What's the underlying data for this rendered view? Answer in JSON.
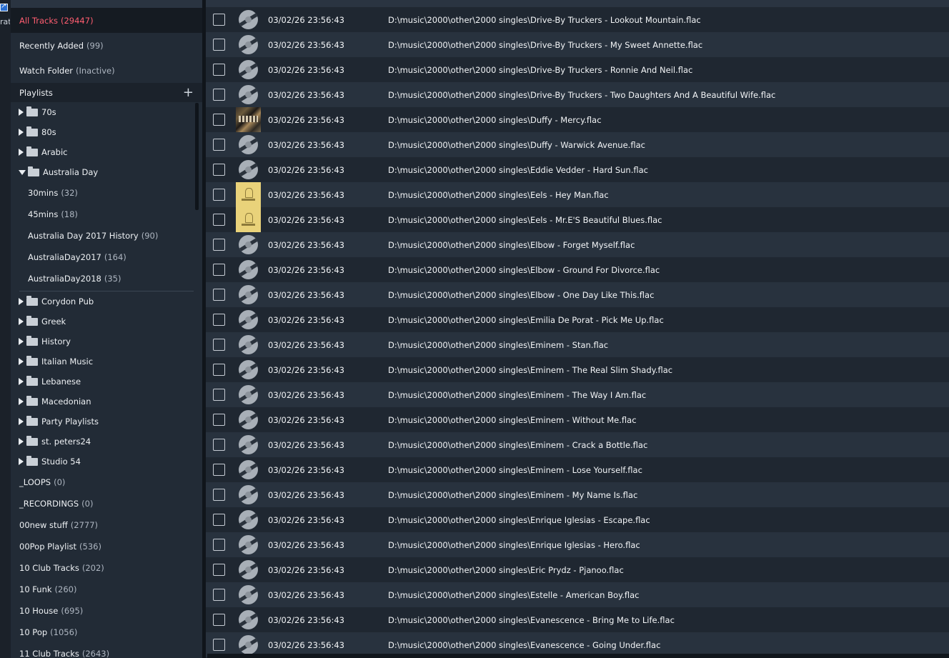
{
  "sidebar": {
    "nav": [
      {
        "label": "All Tracks",
        "count": "(29447)",
        "active": true
      },
      {
        "label": "Recently Added",
        "count": "(99)",
        "active": false
      },
      {
        "label": "Watch Folder",
        "count": "(Inactive)",
        "active": false
      }
    ],
    "playlists_header": "Playlists",
    "add_icon": "+",
    "folders_top": [
      {
        "label": "70s",
        "open": false
      },
      {
        "label": "80s",
        "open": false
      },
      {
        "label": "Arabic",
        "open": false
      },
      {
        "label": "Australia Day",
        "open": true
      }
    ],
    "australia_day_children": [
      {
        "label": "30mins",
        "count": "(32)"
      },
      {
        "label": "45mins",
        "count": "(18)"
      },
      {
        "label": "Australia Day 2017 History",
        "count": "(90)"
      },
      {
        "label": "AustraliaDay2017",
        "count": "(164)"
      },
      {
        "label": "AustraliaDay2018",
        "count": "(35)"
      }
    ],
    "folders_bottom": [
      {
        "label": "Corydon Pub"
      },
      {
        "label": "Greek"
      },
      {
        "label": "History"
      },
      {
        "label": "Italian Music"
      },
      {
        "label": "Lebanese"
      },
      {
        "label": "Macedonian"
      },
      {
        "label": "Party Playlists"
      },
      {
        "label": "st. peters24"
      },
      {
        "label": "Studio 54"
      }
    ],
    "playlists": [
      {
        "label": "_LOOPS",
        "count": "(0)"
      },
      {
        "label": "_RECORDINGS",
        "count": "(0)"
      },
      {
        "label": "00new stuff",
        "count": "(2777)"
      },
      {
        "label": "00Pop Playlist",
        "count": "(536)"
      },
      {
        "label": "10 Club Tracks",
        "count": "(202)"
      },
      {
        "label": "10 Funk",
        "count": "(260)"
      },
      {
        "label": "10 House",
        "count": "(695)"
      },
      {
        "label": "10 Pop",
        "count": "(1056)"
      },
      {
        "label": "11 Club Tracks",
        "count": "(2643)"
      }
    ]
  },
  "edge_fragment": "rat",
  "tracks": [
    {
      "date": "03/02/26 23:56:43",
      "path": "D:\\music\\2000\\other\\2000 singles\\Drive-By Truckers - Lookout Mountain.flac",
      "art": "disc"
    },
    {
      "date": "03/02/26 23:56:43",
      "path": "D:\\music\\2000\\other\\2000 singles\\Drive-By Truckers - My Sweet Annette.flac",
      "art": "disc"
    },
    {
      "date": "03/02/26 23:56:43",
      "path": "D:\\music\\2000\\other\\2000 singles\\Drive-By Truckers - Ronnie And Neil.flac",
      "art": "disc"
    },
    {
      "date": "03/02/26 23:56:43",
      "path": "D:\\music\\2000\\other\\2000 singles\\Drive-By Truckers - Two Daughters And A Beautiful Wife.flac",
      "art": "disc"
    },
    {
      "date": "03/02/26 23:56:43",
      "path": "D:\\music\\2000\\other\\2000 singles\\Duffy - Mercy.flac",
      "art": "dark"
    },
    {
      "date": "03/02/26 23:56:43",
      "path": "D:\\music\\2000\\other\\2000 singles\\Duffy - Warwick Avenue.flac",
      "art": "disc"
    },
    {
      "date": "03/02/26 23:56:43",
      "path": "D:\\music\\2000\\other\\2000 singles\\Eddie Vedder - Hard Sun.flac",
      "art": "disc"
    },
    {
      "date": "03/02/26 23:56:43",
      "path": "D:\\music\\2000\\other\\2000 singles\\Eels - Hey Man.flac",
      "art": "yellow"
    },
    {
      "date": "03/02/26 23:56:43",
      "path": "D:\\music\\2000\\other\\2000 singles\\Eels - Mr.E'S Beautiful Blues.flac",
      "art": "yellow"
    },
    {
      "date": "03/02/26 23:56:43",
      "path": "D:\\music\\2000\\other\\2000 singles\\Elbow - Forget Myself.flac",
      "art": "disc"
    },
    {
      "date": "03/02/26 23:56:43",
      "path": "D:\\music\\2000\\other\\2000 singles\\Elbow - Ground For Divorce.flac",
      "art": "disc"
    },
    {
      "date": "03/02/26 23:56:43",
      "path": "D:\\music\\2000\\other\\2000 singles\\Elbow - One Day Like This.flac",
      "art": "disc"
    },
    {
      "date": "03/02/26 23:56:43",
      "path": "D:\\music\\2000\\other\\2000 singles\\Emilia De Porat - Pick Me Up.flac",
      "art": "disc"
    },
    {
      "date": "03/02/26 23:56:43",
      "path": "D:\\music\\2000\\other\\2000 singles\\Eminem - Stan.flac",
      "art": "disc"
    },
    {
      "date": "03/02/26 23:56:43",
      "path": "D:\\music\\2000\\other\\2000 singles\\Eminem - The Real Slim Shady.flac",
      "art": "disc"
    },
    {
      "date": "03/02/26 23:56:43",
      "path": "D:\\music\\2000\\other\\2000 singles\\Eminem - The Way I Am.flac",
      "art": "disc"
    },
    {
      "date": "03/02/26 23:56:43",
      "path": "D:\\music\\2000\\other\\2000 singles\\Eminem - Without Me.flac",
      "art": "disc"
    },
    {
      "date": "03/02/26 23:56:43",
      "path": "D:\\music\\2000\\other\\2000 singles\\Eminem - Crack a Bottle.flac",
      "art": "disc"
    },
    {
      "date": "03/02/26 23:56:43",
      "path": "D:\\music\\2000\\other\\2000 singles\\Eminem - Lose Yourself.flac",
      "art": "disc"
    },
    {
      "date": "03/02/26 23:56:43",
      "path": "D:\\music\\2000\\other\\2000 singles\\Eminem - My Name Is.flac",
      "art": "disc"
    },
    {
      "date": "03/02/26 23:56:43",
      "path": "D:\\music\\2000\\other\\2000 singles\\Enrique Iglesias - Escape.flac",
      "art": "disc"
    },
    {
      "date": "03/02/26 23:56:43",
      "path": "D:\\music\\2000\\other\\2000 singles\\Enrique Iglesias - Hero.flac",
      "art": "disc"
    },
    {
      "date": "03/02/26 23:56:43",
      "path": "D:\\music\\2000\\other\\2000 singles\\Eric Prydz - Pjanoo.flac",
      "art": "disc"
    },
    {
      "date": "03/02/26 23:56:43",
      "path": "D:\\music\\2000\\other\\2000 singles\\Estelle - American Boy.flac",
      "art": "disc"
    },
    {
      "date": "03/02/26 23:56:43",
      "path": "D:\\music\\2000\\other\\2000 singles\\Evanescence - Bring Me to Life.flac",
      "art": "disc"
    },
    {
      "date": "03/02/26 23:56:43",
      "path": "D:\\music\\2000\\other\\2000 singles\\Evanescence - Going Under.flac",
      "art": "disc"
    }
  ],
  "colors": {
    "accent": "#ff5d70",
    "sidebar_bg": "#222b36",
    "row_even": "#28323e",
    "row_odd": "#1f2731"
  }
}
